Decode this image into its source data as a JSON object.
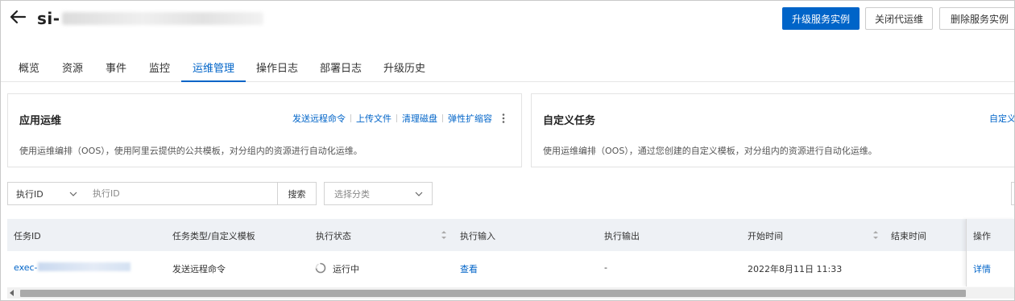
{
  "header": {
    "title_prefix": "si-",
    "upgrade_label": "升级服务实例",
    "close_ops_label": "关闭代运维",
    "delete_label": "删除服务实例"
  },
  "tabs": [
    {
      "label": "概览"
    },
    {
      "label": "资源"
    },
    {
      "label": "事件"
    },
    {
      "label": "监控"
    },
    {
      "label": "运维管理"
    },
    {
      "label": "操作日志"
    },
    {
      "label": "部署日志"
    },
    {
      "label": "升级历史"
    }
  ],
  "active_tab": "运维管理",
  "app_ops": {
    "title": "应用运维",
    "links": [
      "发送远程命令",
      "上传文件",
      "清理磁盘",
      "弹性扩缩容"
    ],
    "description": "使用运维编排（OOS），使用阿里云提供的公共模板，对分组内的资源进行自动化运维。"
  },
  "custom_task": {
    "title": "自定义任务",
    "link": "自定义",
    "description": "使用运维编排（OOS），通过您创建的自定义模板，对分组内的资源进行自动化运维。"
  },
  "filter": {
    "field_select": "执行ID",
    "search_placeholder": "执行ID",
    "search_button": "搜索",
    "category_placeholder": "选择分类"
  },
  "table": {
    "columns": [
      "任务ID",
      "任务类型/自定义模板",
      "执行状态",
      "执行输入",
      "执行输出",
      "开始时间",
      "结束时间",
      "操作"
    ],
    "rows": [
      {
        "task_id_prefix": "exec-",
        "task_type": "发送远程命令",
        "status": "运行中",
        "input": "查看",
        "output": "-",
        "start_time": "2022年8月11日 11:33",
        "end_time": "",
        "action": "详情"
      }
    ]
  },
  "colors": {
    "primary": "#0064c8",
    "header_bg": "#eef1f5"
  }
}
